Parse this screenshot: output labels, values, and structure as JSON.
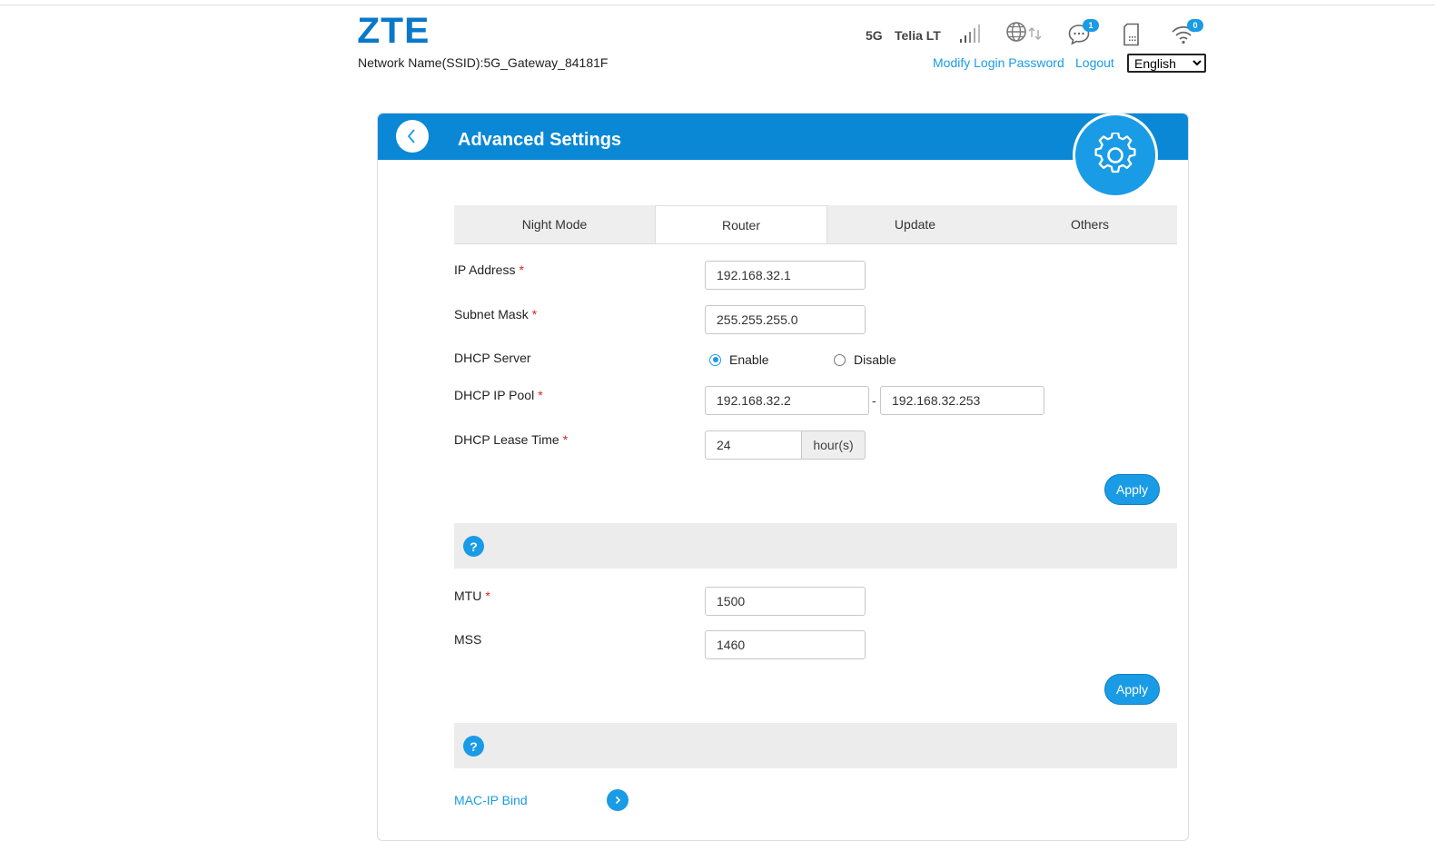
{
  "header": {
    "logo": "ZTE",
    "ssid_label": "Network Name(SSID):5G_Gateway_84181F",
    "network_type": "5G",
    "operator": "Telia LT",
    "messages_badge": "1",
    "wifi_badge": "0",
    "modify_password": "Modify Login Password",
    "logout": "Logout",
    "language": {
      "selected": "English",
      "options": [
        "English"
      ]
    }
  },
  "card": {
    "title": "Advanced Settings",
    "icon": "gear-icon"
  },
  "tabs": [
    {
      "label": "Night Mode",
      "active": false
    },
    {
      "label": "Router",
      "active": true
    },
    {
      "label": "Update",
      "active": false
    },
    {
      "label": "Others",
      "active": false
    }
  ],
  "lan": {
    "ip_label": "IP Address",
    "ip_value": "192.168.32.1",
    "mask_label": "Subnet Mask",
    "mask_value": "255.255.255.0",
    "dhcp_label": "DHCP Server",
    "dhcp_enable": "Enable",
    "dhcp_disable": "Disable",
    "dhcp_selected": "Enable",
    "pool_label": "DHCP IP Pool",
    "pool_start": "192.168.32.2",
    "pool_sep": "-",
    "pool_end": "192.168.32.253",
    "lease_label": "DHCP Lease Time",
    "lease_value": "24",
    "lease_unit": "hour(s)",
    "apply": "Apply"
  },
  "mtu": {
    "mtu_label": "MTU",
    "mtu_value": "1500",
    "mss_label": "MSS",
    "mss_value": "1460",
    "apply": "Apply"
  },
  "help_glyph": "?",
  "required_mark": "*",
  "mac_ip_bind": "MAC-IP Bind",
  "colors": {
    "brand": "#0a78c8",
    "header_bar": "#0a88d6",
    "accent": "#1a9be6",
    "required": "#e02020"
  }
}
